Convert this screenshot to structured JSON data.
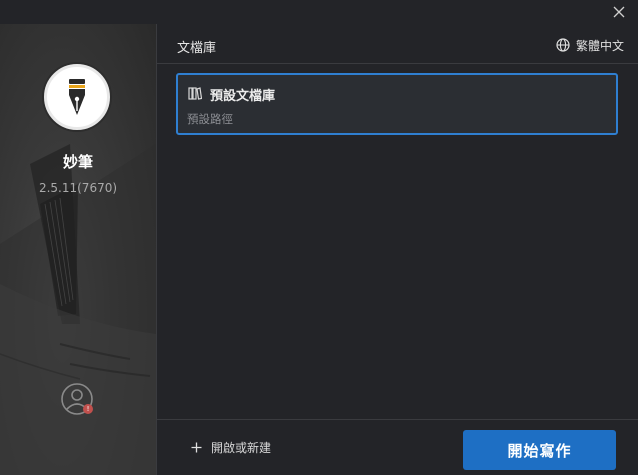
{
  "window": {
    "close_icon": "close-icon"
  },
  "sidebar": {
    "logo_icon": "fountain-pen-icon",
    "app_name": "妙筆",
    "version": "2.5.11(7670)",
    "user_icon": "user-icon",
    "user_badge": "!"
  },
  "header": {
    "title": "文檔庫",
    "language_icon": "globe-icon",
    "language_label": "繁體中文"
  },
  "libraries": [
    {
      "icon": "library-icon",
      "name": "預設文檔庫",
      "path": "預設路徑",
      "selected": true
    }
  ],
  "footer": {
    "open_icon": "plus-icon",
    "open_label": "開啟或新建",
    "start_label": "開始寫作"
  },
  "colors": {
    "accent": "#1e6fc4",
    "selection_border": "#2f7fd1",
    "background": "#232428",
    "badge": "#c0504d"
  }
}
